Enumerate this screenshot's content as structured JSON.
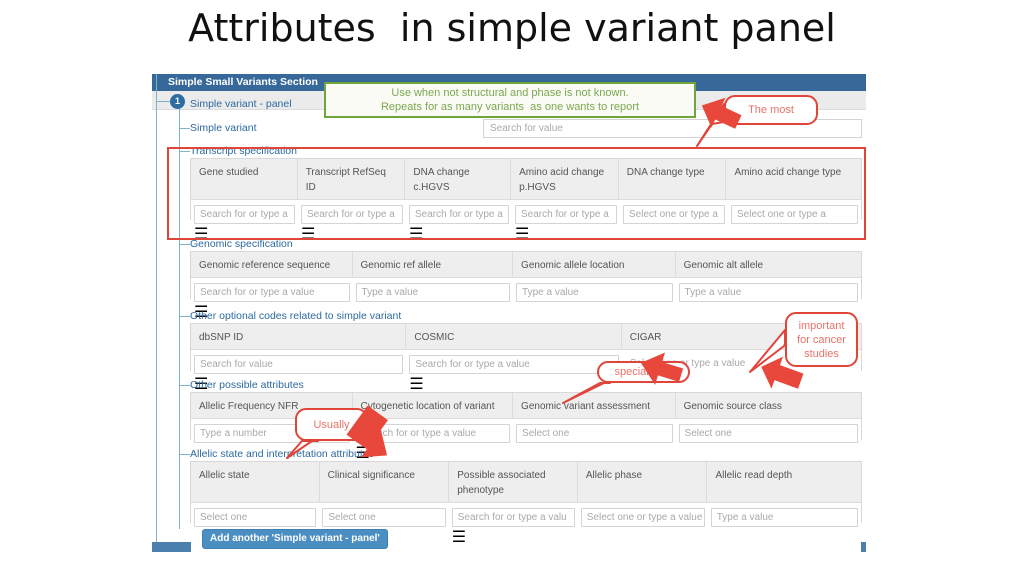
{
  "slide": {
    "title": "Attributes  in simple variant panel"
  },
  "panel": {
    "header_title": "Simple Small Variants Section",
    "node_number": "1",
    "node_label": "Simple variant - panel",
    "simple_variant_label": "Simple variant",
    "simple_variant_input": "Search for value",
    "add_another_label": "Add another 'Simple variant - panel'"
  },
  "sections": [
    {
      "id": "transcript-specification",
      "label": "Transcript specification",
      "columns": [
        {
          "header": "Gene studied",
          "placeholder": "Search for or type a ",
          "widget": "search"
        },
        {
          "header": "Transcript RefSeq ID",
          "placeholder": "Search for or type a ",
          "widget": "search"
        },
        {
          "header": "DNA change c.HGVS",
          "placeholder": "Search for or type a ",
          "widget": "search"
        },
        {
          "header": "Amino acid change p.HGVS",
          "placeholder": "Search for or type a ",
          "widget": "search"
        },
        {
          "header": "DNA change type",
          "placeholder": "Select one or type a ",
          "widget": "select"
        },
        {
          "header": "Amino acid change type",
          "placeholder": "Select one or type a ",
          "widget": "select"
        }
      ]
    },
    {
      "id": "genomic-specification",
      "label": "Genomic specification",
      "columns": [
        {
          "header": "Genomic reference sequence",
          "placeholder": "Search for or type a value",
          "widget": "search"
        },
        {
          "header": "Genomic ref allele",
          "placeholder": "Type a value",
          "widget": "text"
        },
        {
          "header": "Genomic allele location",
          "placeholder": "Type a value",
          "widget": "text"
        },
        {
          "header": "Genomic alt allele",
          "placeholder": "Type a value",
          "widget": "text"
        }
      ]
    },
    {
      "id": "other-optional-codes",
      "label": "Other optional codes related to simple variant",
      "columns": [
        {
          "header": "dbSNP ID",
          "placeholder": "Search for value",
          "widget": "search"
        },
        {
          "header": "COSMIC",
          "placeholder": "Search for or type a value",
          "widget": "search"
        },
        {
          "header": "CIGAR",
          "placeholder": "Select one or type a value",
          "widget": "plain"
        }
      ]
    },
    {
      "id": "other-possible-attributes",
      "label": "Other possible attributes",
      "columns": [
        {
          "header": "Allelic Frequency NFR",
          "placeholder": "Type a number",
          "widget": "text"
        },
        {
          "header": "Cytogenetic location of variant",
          "placeholder": "Search for or type a value",
          "widget": "search"
        },
        {
          "header": "Genomic variant assessment",
          "placeholder": "Select one",
          "widget": "select"
        },
        {
          "header": "Genomic source class",
          "placeholder": "Select one",
          "widget": "select"
        }
      ]
    },
    {
      "id": "allelic-state-and-interpretation",
      "label": "Allelic state and interpretation attributes",
      "columns": [
        {
          "header": "Allelic state",
          "placeholder": "Select one",
          "widget": "select"
        },
        {
          "header": "Clinical significance",
          "placeholder": "Select one",
          "widget": "select"
        },
        {
          "header": "Possible associated phenotype",
          "placeholder": "Search for or type a valu",
          "widget": "search"
        },
        {
          "header": "Allelic phase",
          "placeholder": "Select one or type a value",
          "widget": "plain"
        },
        {
          "header": "Allelic read depth",
          "placeholder": "Type a value",
          "widget": "text"
        }
      ]
    }
  ],
  "annotations": {
    "green_note": "Use when not structural and phase is not known.\nRepeats for as many variants  as one wants to report",
    "the_most": "The most",
    "important_for_cancer": "important\nfor cancer\nstudies",
    "special_use": "special  use",
    "usually": "Usually"
  },
  "colors": {
    "header_blue": "#36689a",
    "footer_blue": "#4a7fae",
    "tree_line": "#7fb3c8",
    "label_blue": "#2d6a9f",
    "annotation_red": "#e0453a",
    "annotation_text_red": "#e8736a",
    "annotation_green": "#6fa53a",
    "button_blue": "#4a8ec2"
  }
}
